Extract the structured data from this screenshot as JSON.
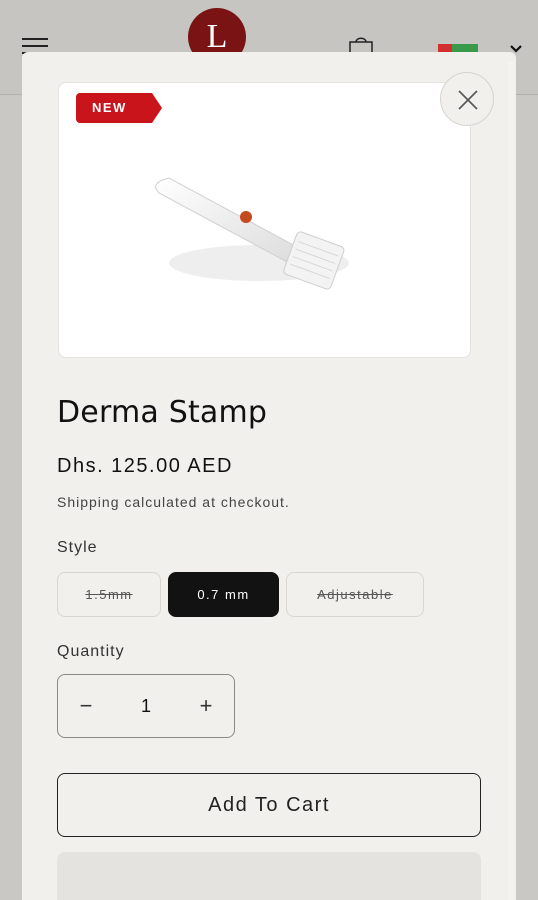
{
  "header": {
    "logo_letter": "L"
  },
  "product": {
    "badge": "NEW",
    "title": "Derma Stamp",
    "price": "Dhs. 125.00 AED",
    "shipping_note": "Shipping calculated at checkout.",
    "style_label": "Style",
    "style_options": [
      {
        "label": "1.5mm",
        "state": "unavailable"
      },
      {
        "label": "0.7 mm",
        "state": "selected"
      },
      {
        "label": "Adjustable",
        "state": "unavailable"
      }
    ],
    "quantity_label": "Quantity",
    "quantity_value": "1",
    "minus_symbol": "−",
    "plus_symbol": "+",
    "add_to_cart_label": "Add To Cart"
  },
  "icons": {
    "menu": "hamburger-icon",
    "cart": "bag-icon",
    "flag": "flag-icon",
    "dropdown": "chevron-down-icon",
    "close": "close-icon"
  },
  "colors": {
    "badge": "#c8141a",
    "logo": "#7a1414",
    "selected_option": "#121212",
    "modal_bg": "#f1f0ed"
  }
}
